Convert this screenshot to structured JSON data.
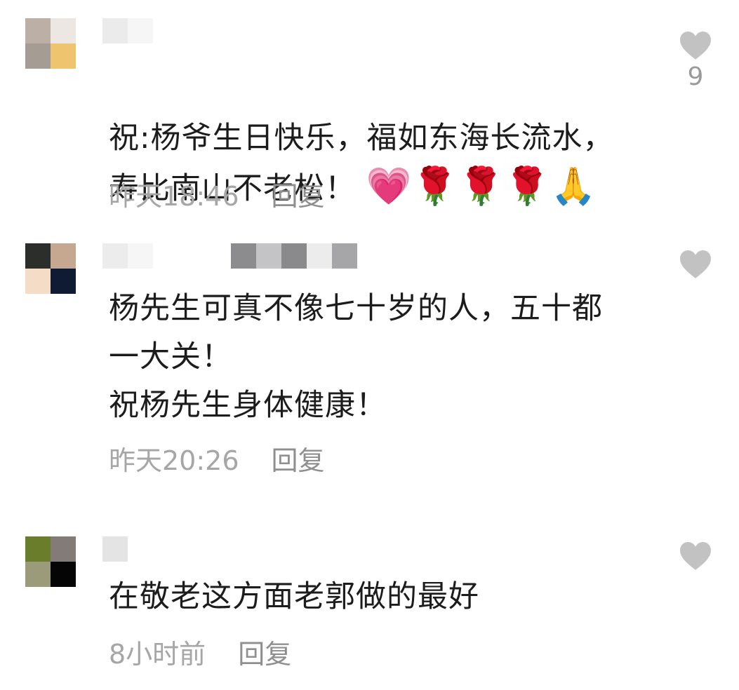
{
  "comments": [
    {
      "text": "祝:杨爷生日快乐，福如东海长流水，\n寿比南山不老松！",
      "emojis": "💗🌹🌹🌹🙏",
      "time": "昨天18:46",
      "reply_label": "回复",
      "like_count": "9",
      "avatar_colors": [
        "#bcb0a6",
        "#ece7e2",
        "#a59c93",
        "#eec46f"
      ],
      "name_blur_colors": [
        "#ebebeb",
        "#f6f6f6"
      ]
    },
    {
      "text": "杨先生可真不像七十岁的人，五十都\n一大关！\n祝杨先生身体健康！",
      "time": "昨天20:26",
      "reply_label": "回复",
      "like_count": "",
      "avatar_colors": [
        "#2b2e2a",
        "#c6a891",
        "#f4dcc6",
        "#0f1a33"
      ],
      "name_blur_colors": [
        "#ececec",
        "#f6f6f6"
      ],
      "sub_blur_colors": [
        "#8c8c8e",
        "#c4c4c7",
        "#8a8a8c",
        "#ececec",
        "#a6a6a8"
      ]
    },
    {
      "text": "在敬老这方面老郭做的最好",
      "time": "8小时前",
      "reply_label": "回复",
      "like_count": "",
      "avatar_colors": [
        "#6a7d2a",
        "#837b78",
        "#9b9a79",
        "#040504"
      ],
      "name_blur_colors": [
        "#e4e4e4"
      ]
    }
  ],
  "icons": {
    "like": "heart-icon",
    "like_color": "#c2c2c2"
  }
}
